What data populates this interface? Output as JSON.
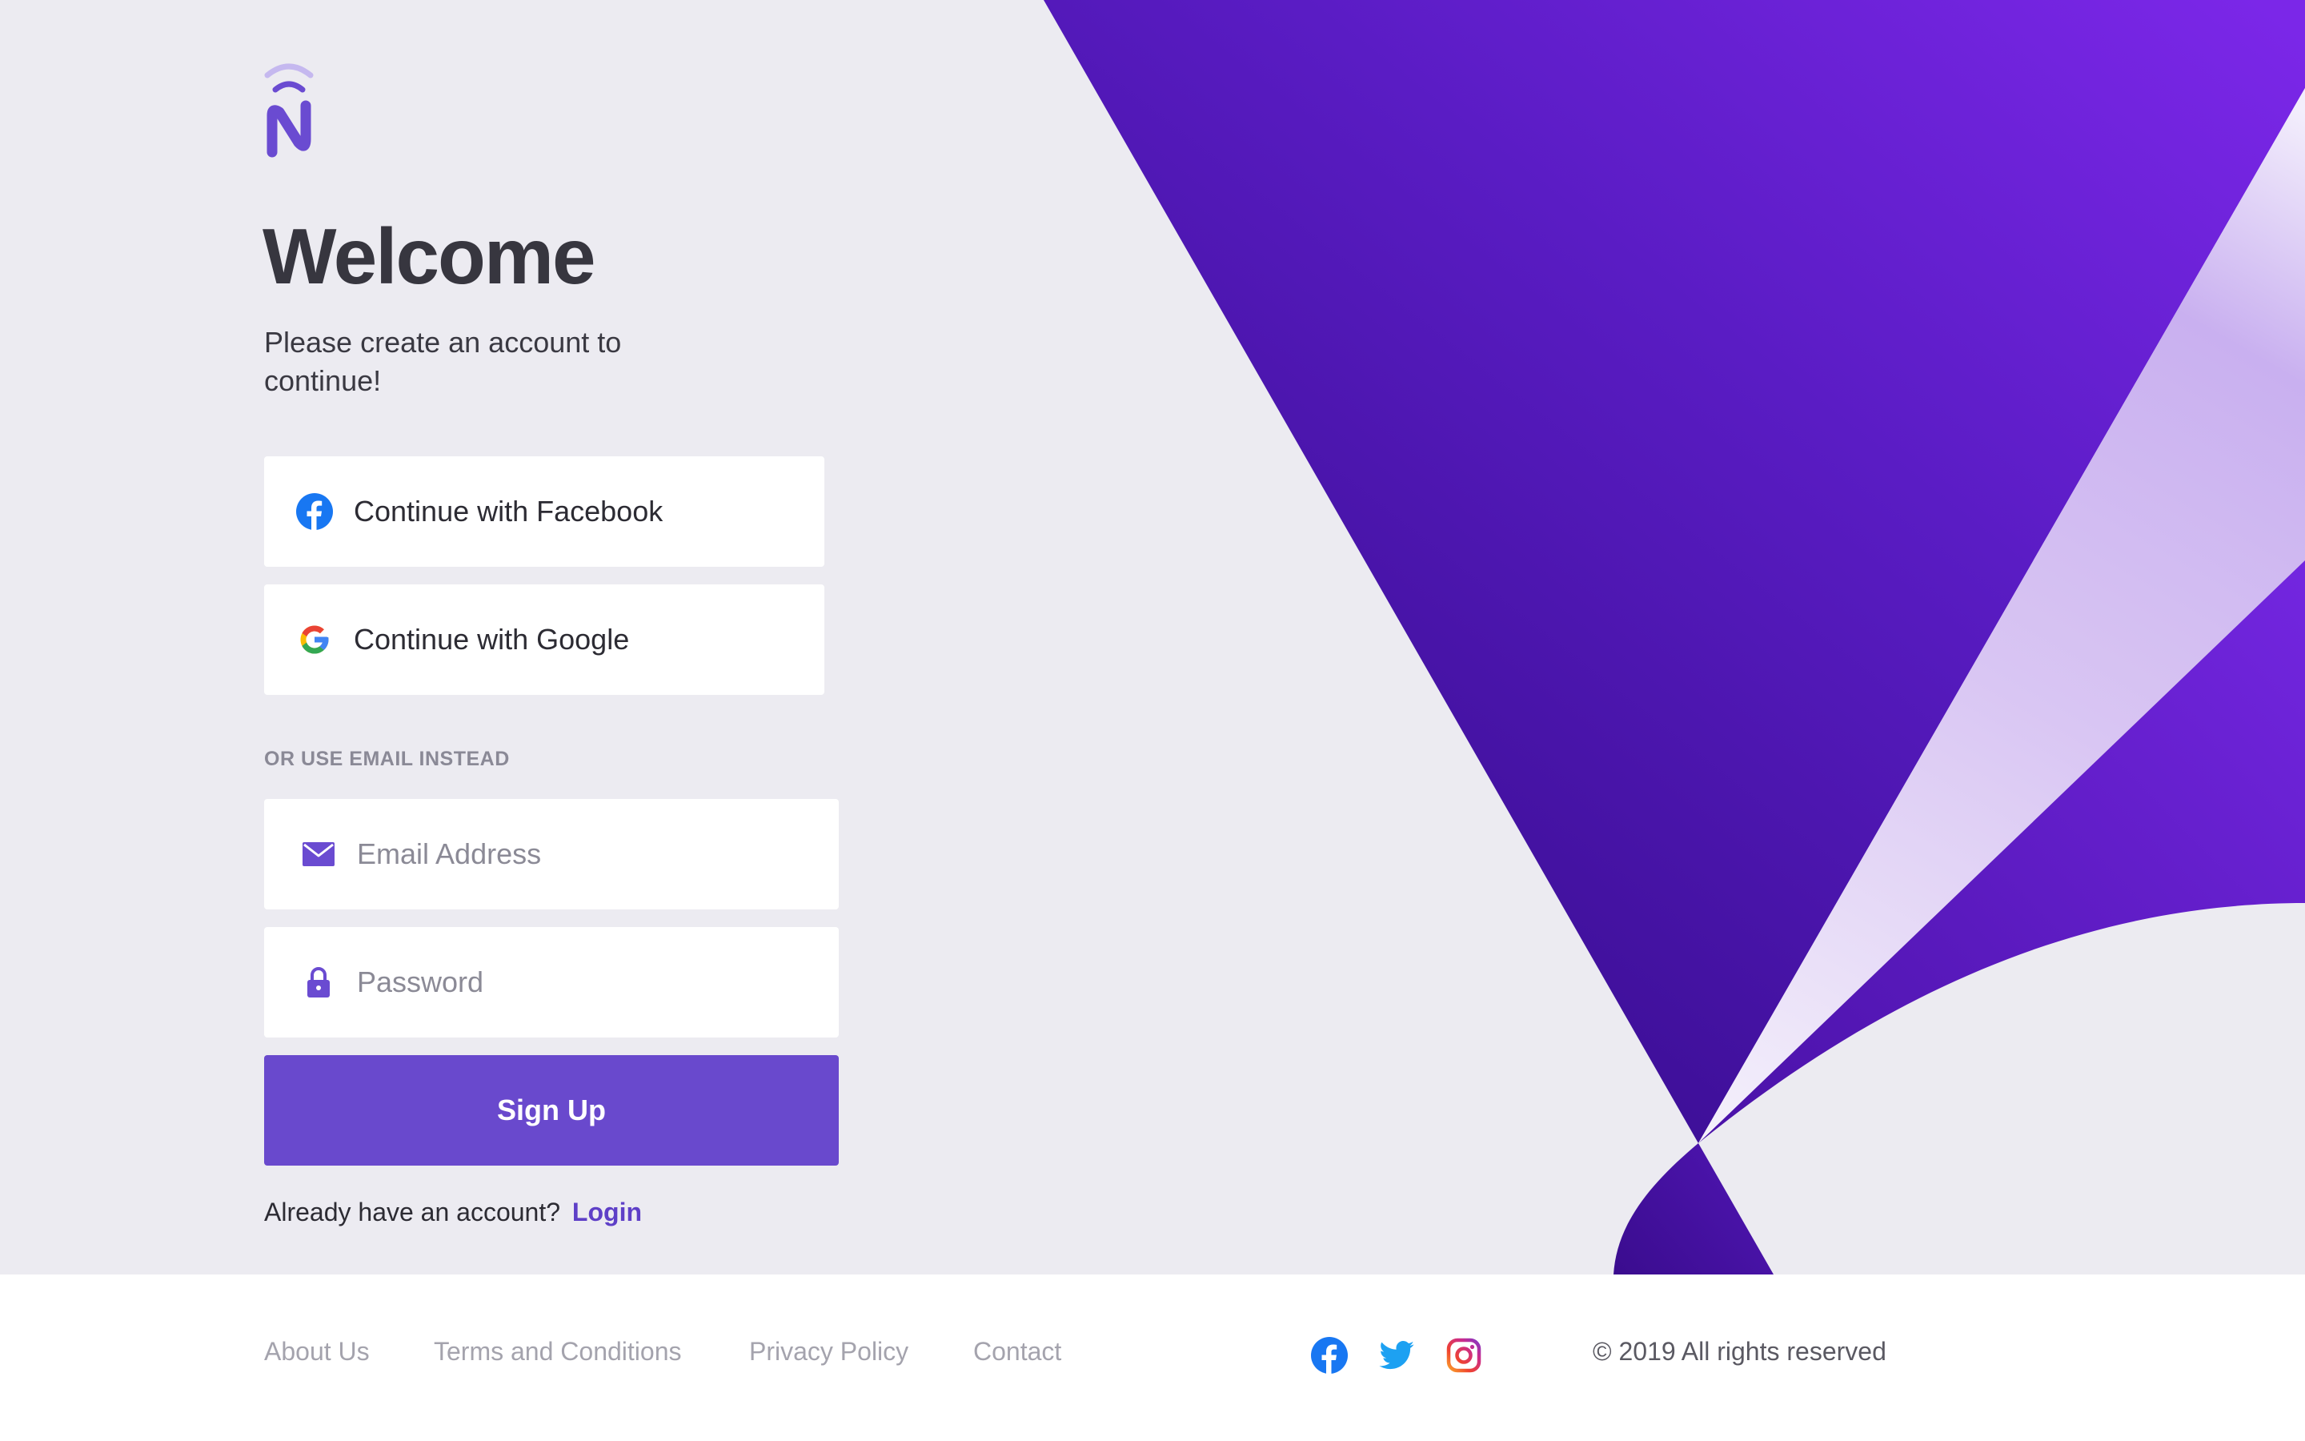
{
  "brand": {
    "logo_icon": "n-signal-logo-icon",
    "accent_color": "#6949cd"
  },
  "hero": {
    "title": "Welcome",
    "subtitle": "Please create an account to continue!"
  },
  "social": {
    "facebook_label": "Continue with Facebook",
    "google_label": "Continue with Google",
    "facebook_icon": "facebook-icon",
    "google_icon": "google-icon"
  },
  "form": {
    "divider": "OR USE EMAIL INSTEAD",
    "email_placeholder": "Email Address",
    "email_value": "",
    "email_icon": "envelope-icon",
    "password_placeholder": "Password",
    "password_value": "",
    "password_icon": "lock-icon",
    "submit_label": "Sign Up"
  },
  "login": {
    "prompt": "Already have an account?",
    "link_label": "Login"
  },
  "footer": {
    "links": [
      "About Us",
      "Terms and Conditions",
      "Privacy Policy",
      "Contact"
    ],
    "social_icons": [
      "facebook-icon",
      "twitter-icon",
      "instagram-icon"
    ],
    "copyright": "© 2019 All rights reserved"
  },
  "colors": {
    "background": "#ecebf1",
    "purple_dark": "#3f0f9a",
    "purple_light": "#7a28e6",
    "text_dark": "#37363f"
  }
}
